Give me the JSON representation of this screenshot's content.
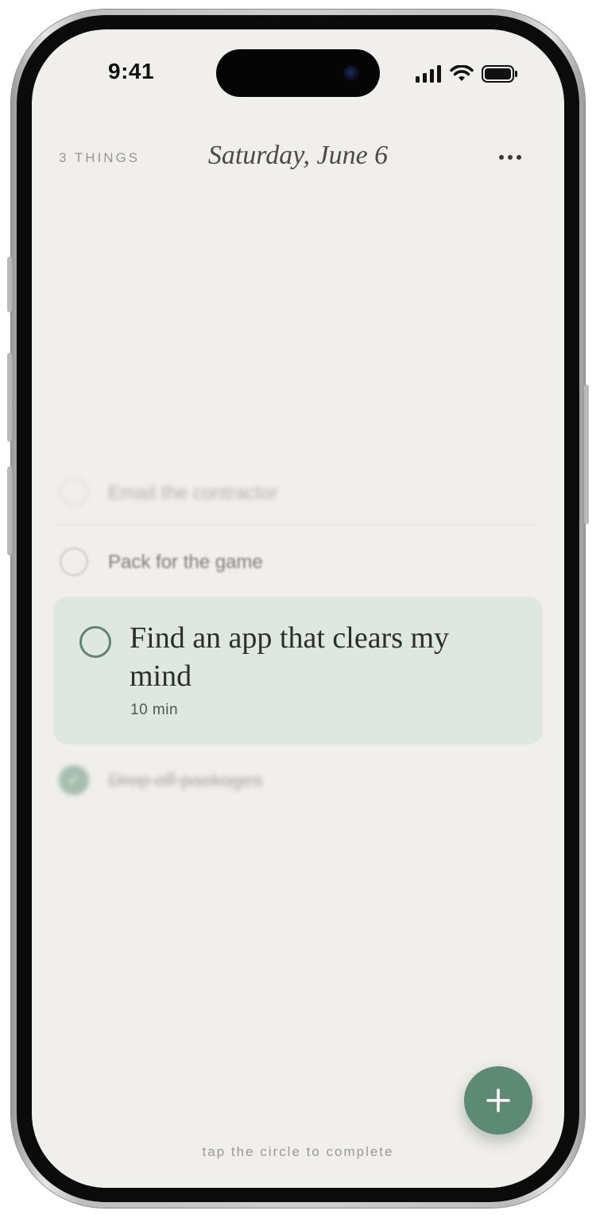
{
  "status_bar": {
    "time": "9:41"
  },
  "header": {
    "count_label": "3 THINGS",
    "date": "Saturday, June 6"
  },
  "tasks": [
    {
      "title": "Email the contractor",
      "state": "faded"
    },
    {
      "title": "Pack for the game",
      "state": "open"
    },
    {
      "title": "Find an app that clears my mind",
      "duration": "10 min",
      "state": "focused"
    },
    {
      "title": "Drop off packages",
      "state": "done"
    }
  ],
  "footer": {
    "hint": "tap the circle to complete"
  },
  "colors": {
    "background": "#f1efeb",
    "focus_card": "#dfe8e0",
    "accent_green": "#5c8a73",
    "done_green": "#a4bfae"
  },
  "icons": [
    "signal-icon",
    "wifi-icon",
    "battery-icon",
    "more-icon",
    "plus-icon",
    "check-icon"
  ]
}
